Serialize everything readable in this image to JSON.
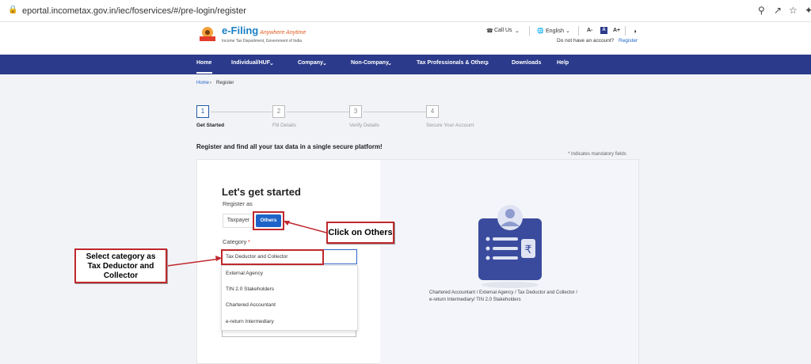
{
  "browser": {
    "url": "eportal.incometax.gov.in/iec/foservices/#/pre-login/register"
  },
  "header": {
    "logo_title": "e-Filing",
    "logo_tagline": "Anywhere Anytime",
    "logo_dept": "Income Tax Department, Government of India",
    "call_us": "Call Us",
    "language": "English",
    "font_small": "A-",
    "font_normal": "A",
    "font_large": "A+",
    "no_account": "Do not have an account?",
    "register_link": "Register"
  },
  "nav": {
    "items": [
      "Home",
      "Individual/HUF",
      "Company",
      "Non-Company",
      "Tax Professionals & Others",
      "Downloads",
      "Help"
    ]
  },
  "breadcrumb": {
    "home": "Home",
    "current": "Register"
  },
  "stepper": {
    "steps": [
      {
        "num": "1",
        "label": "Get Started"
      },
      {
        "num": "2",
        "label": "Fill Details"
      },
      {
        "num": "3",
        "label": "Verify Details"
      },
      {
        "num": "4",
        "label": "Secure Your Account"
      }
    ]
  },
  "intro": "Register and find all your tax data in a single secure platform!",
  "mandatory_note": "* Indicates mandatory fields",
  "form": {
    "heading": "Let's get started",
    "register_as": "Register as",
    "taxpayer": "Taxpayer",
    "others": "Others",
    "category_label": "Category",
    "required_mark": "*",
    "options": [
      "Tax Deductor and Collector",
      "External Agency",
      "TIN 2.0 Stakeholders",
      "Chartered Accountant",
      "e-return Intermediary"
    ]
  },
  "illustration_caption": {
    "line1": "Chartered Accountant / External Agency / Tax Deductor and Collector /",
    "line2": "e-return Intermediary/ TIN 2.0 Stakeholders"
  },
  "callouts": {
    "others": "Click on Others",
    "category_l1": "Select category as",
    "category_l2": "Tax Deductor and",
    "category_l3": "Collector"
  },
  "colors": {
    "nav_bg": "#2b3a8b",
    "accent": "#1e64c8",
    "callout_border": "#c0282d"
  }
}
